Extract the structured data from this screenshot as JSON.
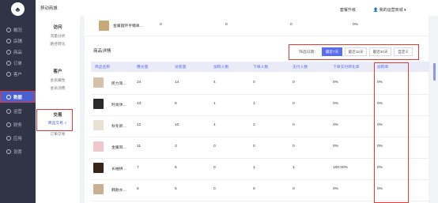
{
  "sidebar": {
    "logo": "♣",
    "items": [
      {
        "label": "概况"
      },
      {
        "label": "店铺"
      },
      {
        "label": "商品"
      },
      {
        "label": "订单"
      },
      {
        "label": "客户"
      },
      {
        "label": "数据"
      },
      {
        "label": "运营"
      },
      {
        "label": "财务"
      },
      {
        "label": "应用"
      },
      {
        "label": "设置"
      }
    ]
  },
  "topbar": {
    "store": "移动商城",
    "upgrade": "套餐升级",
    "user": "我的运营商城"
  },
  "submenu": [
    {
      "title": "访问",
      "links": [
        "流量分析",
        "路径转化"
      ]
    },
    {
      "title": "客户",
      "links": [
        "会员属性",
        "会员消费"
      ]
    },
    {
      "title": "交易",
      "links": [
        "商品交易 ✓",
        "订单交易"
      ]
    }
  ],
  "prev_row": {
    "name": "金属圆环手镯单…",
    "v1": "0",
    "v2": "0",
    "v3": "0",
    "v4": "0%"
  },
  "section_title": "商品详情",
  "filter": {
    "label": "筛选日期：",
    "buttons": [
      "最近7天",
      "最近15天",
      "最近30天",
      "自定义"
    ]
  },
  "table": {
    "headers": [
      "商品名称",
      "曝光量",
      "访客量",
      "加购人数",
      "下单人数",
      "支付人数",
      "下单支付转化率",
      "加购率"
    ],
    "rows": [
      {
        "name": "民力简…",
        "c1": "24",
        "c2": "14",
        "c3": "4",
        "c4": "0",
        "c5": "0",
        "c6": "0%",
        "c7": "0%"
      },
      {
        "name": "时尚休…",
        "c1": "13",
        "c2": "8",
        "c3": "1",
        "c4": "1",
        "c5": "0",
        "c6": "0%",
        "c7": "0%"
      },
      {
        "name": "秋冬新…",
        "c1": "12",
        "c2": "10",
        "c3": "1",
        "c4": "2",
        "c5": "0",
        "c6": "0%",
        "c7": "0%"
      },
      {
        "name": "金属耳…",
        "c1": "11",
        "c2": "3",
        "c3": "0",
        "c4": "0",
        "c5": "0",
        "c6": "0%",
        "c7": "0%"
      },
      {
        "name": "长袖拼…",
        "c1": "7",
        "c2": "6",
        "c3": "0",
        "c4": "1",
        "c5": "1",
        "c6": "100.00%",
        "c7": "0%"
      },
      {
        "name": "韩款水…",
        "c1": "6",
        "c2": "5",
        "c3": "0",
        "c4": "0",
        "c5": "0",
        "c6": "0%",
        "c7": "0%"
      }
    ]
  },
  "colors": {
    "accent": "#5a6df0",
    "sidebar": "#2f3447",
    "highlight": "#e53935"
  }
}
